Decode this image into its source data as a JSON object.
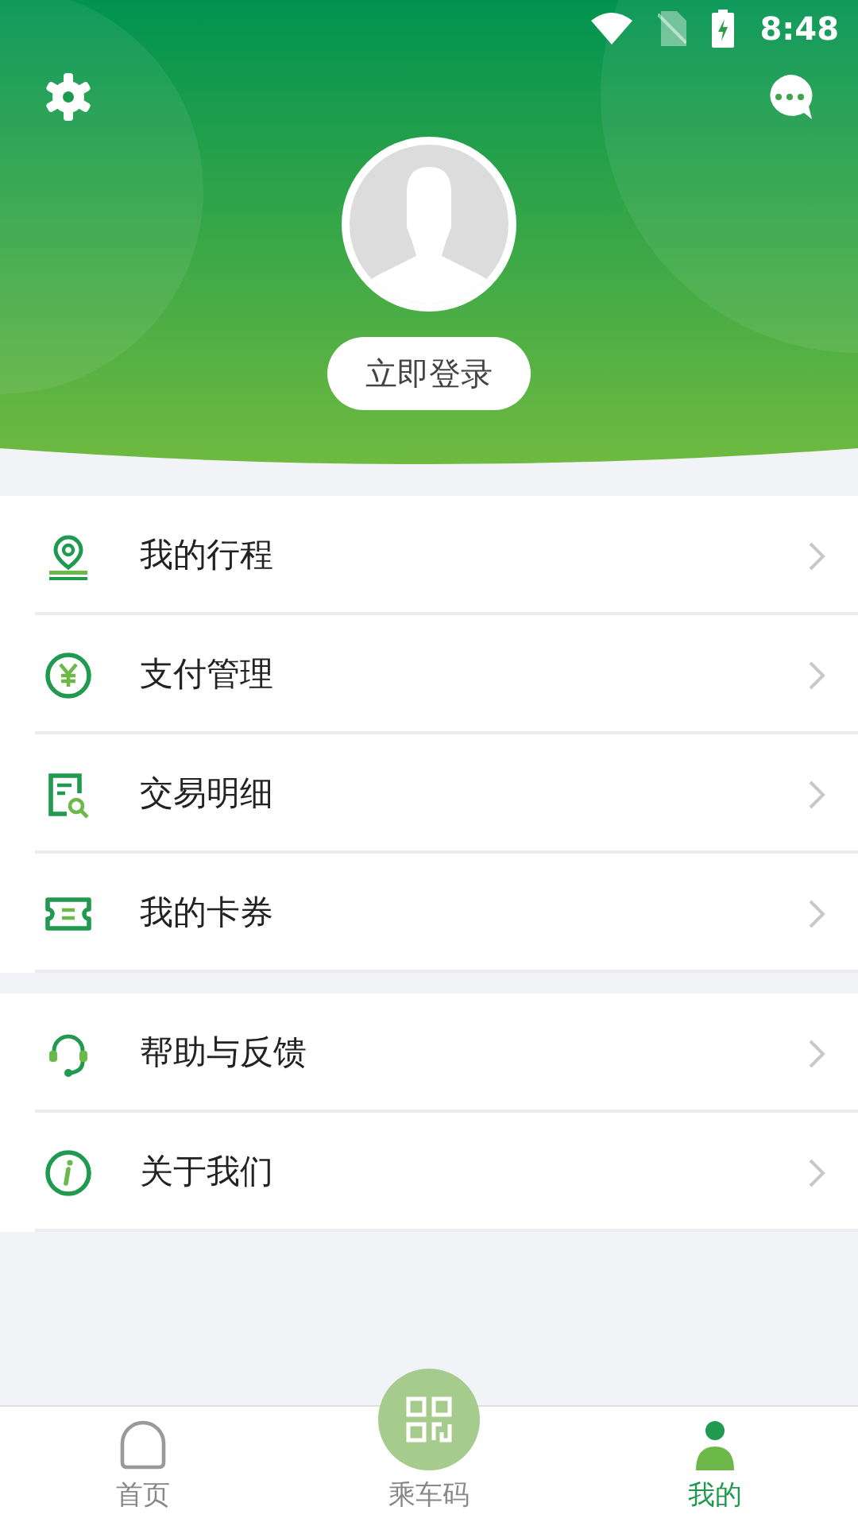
{
  "status_bar": {
    "time": "8:48"
  },
  "header": {
    "login_button": "立即登录"
  },
  "menu_groups": [
    {
      "items": [
        {
          "label": "我的行程"
        },
        {
          "label": "支付管理"
        },
        {
          "label": "交易明细"
        },
        {
          "label": "我的卡券"
        }
      ]
    },
    {
      "items": [
        {
          "label": "帮助与反馈"
        },
        {
          "label": "关于我们"
        }
      ]
    }
  ],
  "tab_bar": [
    {
      "label": "首页",
      "kind": "normal",
      "selected": false
    },
    {
      "label": "乘车码",
      "kind": "center",
      "selected": false
    },
    {
      "label": "我的",
      "kind": "normal",
      "selected": true
    }
  ]
}
